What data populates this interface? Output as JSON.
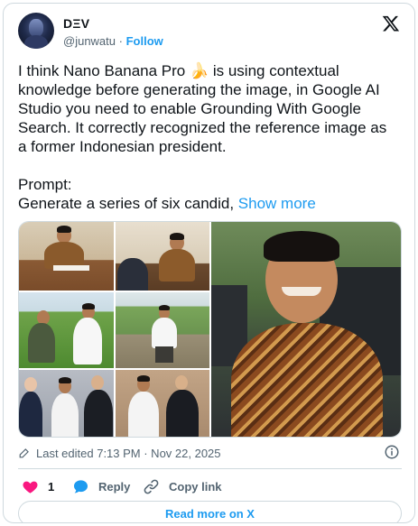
{
  "author": {
    "display_name": "DΞV",
    "handle": "@junwatu",
    "follow_label": "Follow",
    "separator": "·",
    "avatar_icon": "avatar"
  },
  "tweet": {
    "text": "I think Nano Banana Pro 🍌 is using contextual knowledge before generating the image, in Google AI Studio you need to enable Grounding With Google Search. It correctly recognized the reference image as a former Indonesian president.\n\nPrompt:\nGenerate a series of six candid, ",
    "show_more_label": "Show more"
  },
  "media": {
    "count": 7,
    "layout": "3x2 grid plus large portrait"
  },
  "meta": {
    "edited_label": "Last edited 7:13 PM · Nov 22, 2025"
  },
  "actions": {
    "like_count": "1",
    "reply_label": "Reply",
    "copy_link_label": "Copy link"
  },
  "cta": {
    "read_more_label": "Read more on X"
  },
  "colors": {
    "accent": "#1d9bf0",
    "like": "#f91880",
    "text_secondary": "#536471",
    "border": "#cfd9de"
  }
}
